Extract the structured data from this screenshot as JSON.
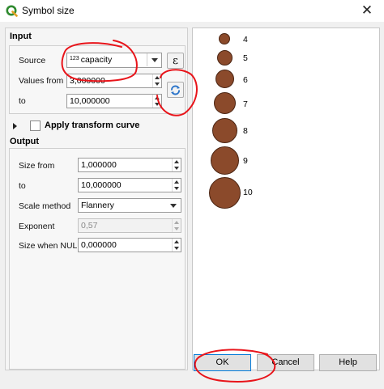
{
  "window": {
    "title": "Symbol size",
    "close_glyph": "✕",
    "icon": "qgis-logo-icon"
  },
  "input": {
    "heading": "Input",
    "source": {
      "label": "Source",
      "value_prefix": "123",
      "value": "capacity",
      "expression_glyph": "ε"
    },
    "values_from": {
      "label": "Values from",
      "value": "3,000000"
    },
    "to": {
      "label": "to",
      "value": "10,000000"
    },
    "refresh_icon": "refresh-icon"
  },
  "transform_curve": {
    "label": "Apply transform curve",
    "checked": false,
    "expanded": false
  },
  "output": {
    "heading": "Output",
    "size_from": {
      "label": "Size from",
      "value": "1,000000"
    },
    "size_to": {
      "label": "to",
      "value": "10,000000"
    },
    "scale_method": {
      "label": "Scale method",
      "value": "Flannery"
    },
    "exponent": {
      "label": "Exponent",
      "value": "0,57",
      "disabled": true
    },
    "size_null": {
      "label": "Size when NULL",
      "value": "0,000000"
    }
  },
  "legend": {
    "items": [
      {
        "label": "4"
      },
      {
        "label": "5"
      },
      {
        "label": "6"
      },
      {
        "label": "7"
      },
      {
        "label": "8"
      },
      {
        "label": "9"
      },
      {
        "label": "10"
      }
    ],
    "symbol_fill": "#8b4a2b",
    "symbol_stroke": "#4a2412"
  },
  "buttons": {
    "ok": "OK",
    "cancel": "Cancel",
    "help": "Help"
  },
  "annotations": {
    "color": "#e8141a"
  }
}
